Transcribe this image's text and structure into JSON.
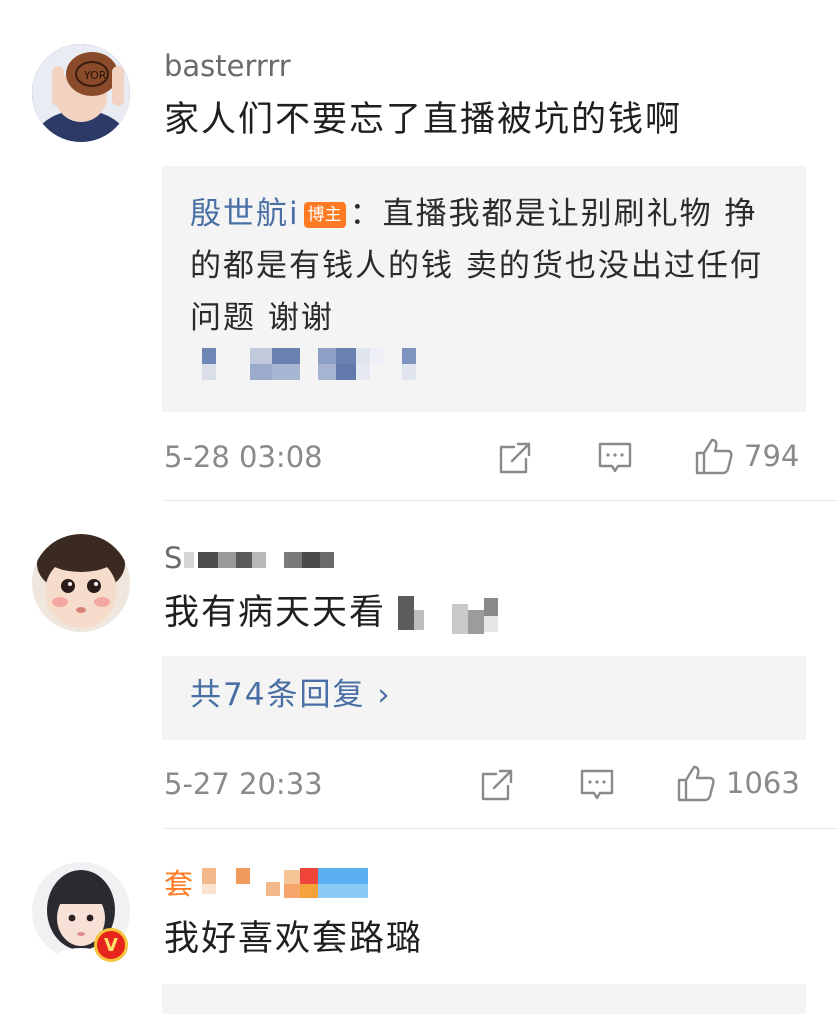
{
  "comments": [
    {
      "username": "basterrrr",
      "text": "家人们不要忘了直播被坑的钱啊",
      "reply": {
        "author": "殷世航i",
        "badge": "博主",
        "separator": "：",
        "text": "直播我都是让别刷礼物 挣的都是有钱人的钱 卖的货也没出过任何问题 谢谢"
      },
      "time": "5-28 03:08",
      "likes": "794"
    },
    {
      "username": "S",
      "text": "我有病天天看",
      "more_replies": "共74条回复 ›",
      "time": "5-27 20:33",
      "likes": "1063"
    },
    {
      "username": "套",
      "text": "我好喜欢套路璐",
      "vip_badge": "V"
    }
  ],
  "icons": {
    "share": "share-icon",
    "comment": "comment-icon",
    "like": "like-icon"
  },
  "colors": {
    "link_blue": "#4a6fa5",
    "badge_orange": "#ff7a22",
    "meta_gray": "#8a8a8a",
    "box_bg": "#f4f4f4"
  }
}
